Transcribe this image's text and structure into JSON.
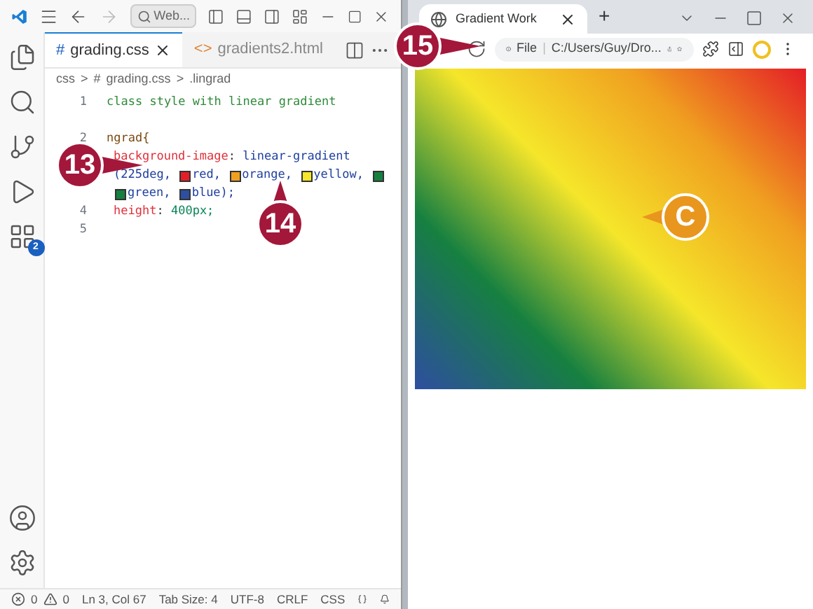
{
  "editor": {
    "search": "Web...",
    "tabs": [
      {
        "label": "grading.css",
        "icon": "#",
        "selected": true
      },
      {
        "label": "gradients2.html",
        "icon": "<>",
        "selected": false
      }
    ],
    "breadcrumb": [
      "css",
      ">",
      "#",
      "grading.css",
      ">",
      ".lingrad"
    ],
    "extensions_badge": "2",
    "lines": [
      {
        "number": "1",
        "indented": false,
        "tokens": [
          {
            "kind": "comment",
            "text": "class style with linear gradient"
          }
        ]
      },
      {
        "number": "2",
        "gap_above": true,
        "indented": false,
        "tokens": [
          {
            "kind": "selector",
            "text": "ngrad{"
          }
        ]
      },
      {
        "indented": true,
        "tokens": [
          {
            "kind": "property",
            "text": "background-image"
          },
          {
            "kind": "plain",
            "text": ": "
          },
          {
            "kind": "value",
            "text": "linear-gradient"
          }
        ]
      },
      {
        "indented": true,
        "tokens": [
          {
            "kind": "value",
            "text": "(225deg, "
          },
          {
            "kind": "swatch",
            "color": "#e41e26"
          },
          {
            "kind": "value",
            "text": "red, "
          },
          {
            "kind": "swatch",
            "color": "#f0a020"
          },
          {
            "kind": "value",
            "text": "orange, "
          },
          {
            "kind": "swatch",
            "color": "#f5e62a"
          },
          {
            "kind": "value",
            "text": "yellow, "
          },
          {
            "kind": "swatch",
            "color": "#168040"
          }
        ]
      },
      {
        "indented": true,
        "tokens": [
          {
            "kind": "swatch",
            "color": "#168040"
          },
          {
            "kind": "value",
            "text": "green, "
          },
          {
            "kind": "swatch",
            "color": "#2e4ea0"
          },
          {
            "kind": "value",
            "text": "blue);"
          }
        ]
      },
      {
        "number": "4",
        "indented": true,
        "tokens": [
          {
            "kind": "property",
            "text": "height"
          },
          {
            "kind": "plain",
            "text": ": "
          },
          {
            "kind": "number",
            "text": "400px;"
          }
        ]
      },
      {
        "number": "5"
      }
    ],
    "status": {
      "errors": "0",
      "warnings": "0",
      "items": [
        "Ln 3, Col 67",
        "Tab Size: 4",
        "UTF-8",
        "CRLF",
        "CSS"
      ]
    }
  },
  "browser": {
    "tab": "Gradient Work",
    "new_tab": "+",
    "address_label": "File",
    "separator": "|",
    "address": "C:/Users/Guy/Dro..."
  },
  "callouts": [
    {
      "text": "13",
      "kind": "right",
      "color": "#a3173a"
    },
    {
      "text": "14",
      "kind": "up",
      "color": "#a3173a"
    },
    {
      "text": "15",
      "kind": "right",
      "color": "#a3173a"
    },
    {
      "text": "C",
      "kind": "left",
      "color": "#e8961e"
    }
  ]
}
